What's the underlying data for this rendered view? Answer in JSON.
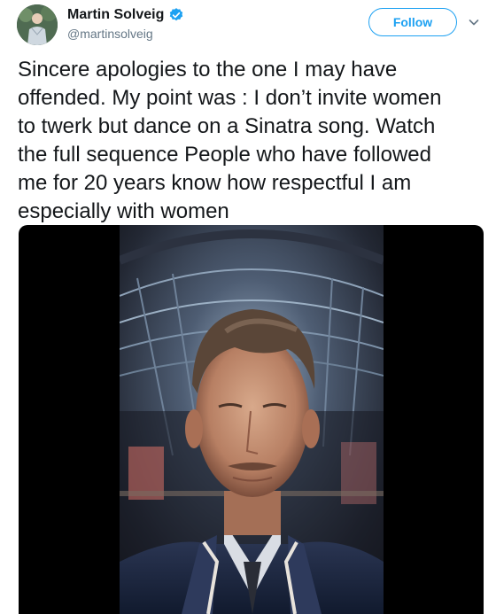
{
  "tweet": {
    "author": {
      "display_name": "Martin Solveig",
      "handle": "@martinsolveig",
      "verified": true
    },
    "follow_label": "Follow",
    "menu_icon": "chevron-down-icon",
    "text": "Sincere apologies to the one I may have\noffended. My point was : I don’t invite women\nto twerk but dance on a Sinatra song. Watch\nthe full sequence People who have followed\nme for 20 years know how respectful I am\nespecially with women",
    "media": {
      "type": "video",
      "icons": [
        "video-thumbnail"
      ]
    }
  },
  "colors": {
    "brand_blue": "#1da1f2",
    "text_primary": "#14171a",
    "text_secondary": "#657786"
  }
}
